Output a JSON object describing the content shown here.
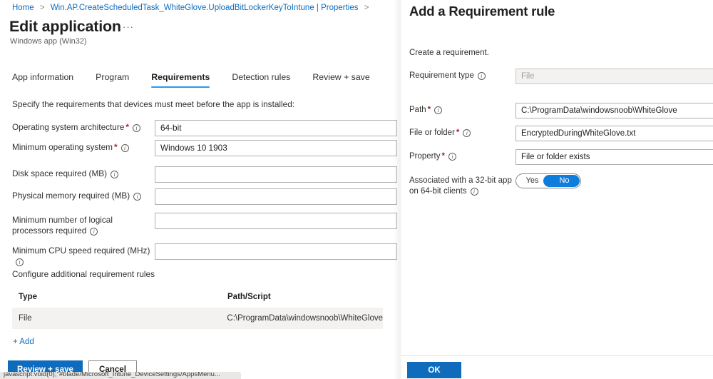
{
  "breadcrumb": {
    "items": [
      "Home",
      "Win.AP.CreateScheduledTask_WhiteGlove.UploadBitLockerKeyToIntune | Properties"
    ],
    "separator": ">"
  },
  "header": {
    "title": "Edit application",
    "subtitle": "Windows app (Win32)",
    "ellipsis": "···"
  },
  "tabs": [
    {
      "label": "App information",
      "active": false
    },
    {
      "label": "Program",
      "active": false
    },
    {
      "label": "Requirements",
      "active": true
    },
    {
      "label": "Detection rules",
      "active": false
    },
    {
      "label": "Review + save",
      "active": false
    }
  ],
  "form": {
    "intro": "Specify the requirements that devices must meet before the app is installed:",
    "fields": [
      {
        "label": "Operating system architecture",
        "required": true,
        "info": true,
        "value": "64-bit",
        "placeholder": ""
      },
      {
        "label": "Minimum operating system",
        "required": true,
        "info": true,
        "value": "Windows 10 1903",
        "placeholder": ""
      },
      {
        "label": "Disk space required (MB)",
        "required": false,
        "info": true,
        "value": "",
        "placeholder": ""
      },
      {
        "label": "Physical memory required (MB)",
        "required": false,
        "info": true,
        "value": "",
        "placeholder": ""
      },
      {
        "label": "Minimum number of logical processors required",
        "required": false,
        "info": true,
        "value": "",
        "placeholder": ""
      },
      {
        "label": "Minimum CPU speed required (MHz)",
        "required": false,
        "info": true,
        "value": "",
        "placeholder": ""
      }
    ]
  },
  "rules": {
    "section_label": "Configure additional requirement rules",
    "columns": [
      "Type",
      "Path/Script"
    ],
    "rows": [
      {
        "type": "File",
        "path": "C:\\ProgramData\\windowsnoob\\WhiteGlove"
      }
    ],
    "add_label": "+ Add"
  },
  "footer": {
    "primary_label": "Review + save",
    "cancel_label": "Cancel",
    "status_text": "javascript:void(0);\"#blade/Microsoft_Intune_DeviceSettings/AppsMenu..."
  },
  "panel": {
    "title": "Add a Requirement rule",
    "intro": "Create a requirement.",
    "fields": [
      {
        "label": "Requirement type",
        "required": false,
        "info": true,
        "value": "File",
        "disabled": true
      },
      {
        "label": "Path",
        "required": true,
        "info": true,
        "value": "C:\\ProgramData\\windowsnoob\\WhiteGlove",
        "disabled": false
      },
      {
        "label": "File or folder",
        "required": true,
        "info": true,
        "value": "EncryptedDuringWhiteGlove.txt",
        "disabled": false
      },
      {
        "label": "Property",
        "required": true,
        "info": true,
        "value": "File or folder exists",
        "disabled": false
      }
    ],
    "toggle": {
      "label_line1": "Associated with a 32-bit app",
      "label_line2": "on 64-bit clients",
      "options": [
        "Yes",
        "No"
      ],
      "selected": "No"
    },
    "ok_label": "OK"
  },
  "colors": {
    "accent": "#0f6cbd",
    "tab_underline": "#2899f5",
    "toggle_on": "#0f7ddb",
    "required_star": "#a4262c",
    "row_bg": "#f3f2f1"
  }
}
